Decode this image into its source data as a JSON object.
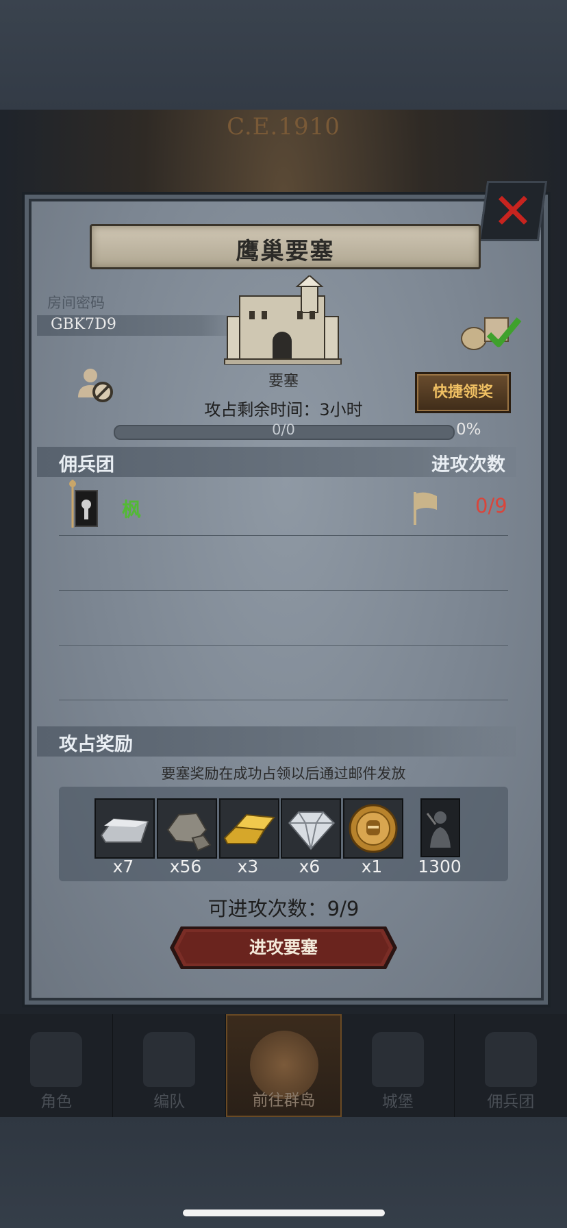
{
  "background": {
    "era_text": "C.E.1910"
  },
  "modal": {
    "title": "鹰巢要塞",
    "room_code_label": "房间密码",
    "room_code": "GBK7D9",
    "fortress_label": "要塞",
    "quick_claim_label": "快捷领奖",
    "time_left_text": "攻占剩余时间：3小时",
    "progress": {
      "text": "0/0",
      "percent_text": "0%",
      "fraction": 0
    },
    "mercenary_section": {
      "title": "佣兵团",
      "attacks_header": "进攻次数",
      "rows": [
        {
          "name": "枫",
          "attack_count": "0/9"
        }
      ]
    },
    "reward_section": {
      "title": "攻占奖励",
      "note": "要塞奖励在成功占领以后通过邮件发放",
      "items": [
        {
          "icon": "silver-ingot-icon",
          "count": "x7"
        },
        {
          "icon": "ore-icon",
          "count": "x56"
        },
        {
          "icon": "gold-bars-icon",
          "count": "x3"
        },
        {
          "icon": "diamond-icon",
          "count": "x6"
        },
        {
          "icon": "knight-medal-icon",
          "count": "x1"
        },
        {
          "icon": "troops-card-icon",
          "count": "1300"
        }
      ]
    },
    "attacks_available_text": "可进攻次数：9/9",
    "attack_button_label": "进攻要塞"
  },
  "bottom_nav": {
    "items": [
      {
        "label": "角色",
        "icon": "character-icon",
        "active": false
      },
      {
        "label": "编队",
        "icon": "formation-icon",
        "active": false
      },
      {
        "label": "前往群岛",
        "icon": "islands-icon",
        "active": true
      },
      {
        "label": "城堡",
        "icon": "castle-nav-icon",
        "active": false
      },
      {
        "label": "佣兵团",
        "icon": "mercenary-icon",
        "active": false
      }
    ]
  },
  "colors": {
    "accent_gold": "#f0c063",
    "merc_name_green": "#53b935",
    "attack_count_red": "#d9453b",
    "close_red": "#c7241f"
  }
}
